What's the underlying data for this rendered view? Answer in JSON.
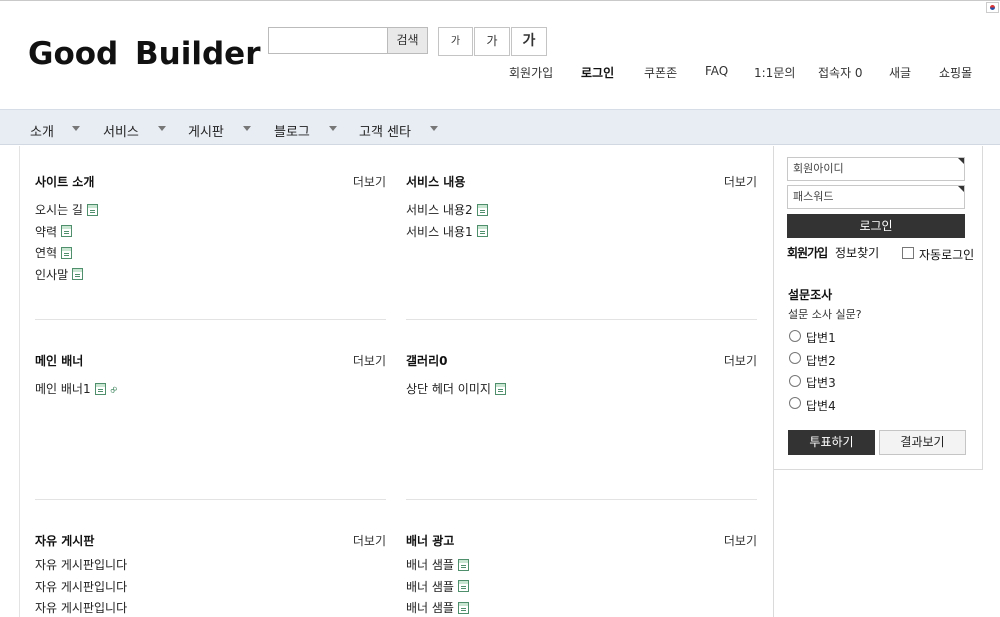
{
  "header": {
    "logo": "Good Builder",
    "search_placeholder": "",
    "search_button": "검색",
    "font_sizes": [
      "가",
      "가",
      "가"
    ],
    "nav": [
      "회원가입",
      "로그인",
      "쿠폰존",
      "FAQ",
      "1:1문의",
      "접속자 0",
      "새글",
      "쇼핑몰"
    ]
  },
  "menu": [
    "소개",
    "서비스",
    "게시판",
    "블로그",
    "고객 센타"
  ],
  "boxes": [
    {
      "title": "사이트 소개",
      "more": "더보기",
      "items": [
        "오시는 길",
        "약력",
        "연혁",
        "인사말"
      ]
    },
    {
      "title": "서비스 내용",
      "more": "더보기",
      "items": [
        "서비스 내용2",
        "서비스 내용1"
      ]
    },
    {
      "title": "메인 배너",
      "more": "더보기",
      "items": [
        "메인 배너1"
      ]
    },
    {
      "title": "갤러리0",
      "more": "더보기",
      "items": [
        "상단 헤더 이미지"
      ]
    },
    {
      "title": "자유 게시판",
      "more": "더보기",
      "items": [
        "자유 게시판입니다",
        "자유 게시판입니다",
        "자유 게시판입니다"
      ]
    },
    {
      "title": "배너 광고",
      "more": "더보기",
      "items": [
        "배너 샘플",
        "배너 샘플",
        "배너 샘플"
      ]
    }
  ],
  "login": {
    "id_placeholder": "회원아이디",
    "pw_placeholder": "패스워드",
    "button": "로그인",
    "join": "회원가입",
    "find": "정보찾기",
    "auto": "자동로그인"
  },
  "poll": {
    "title": "설문조사",
    "question": "설문 소사 실문?",
    "options": [
      "답변1",
      "답변2",
      "답변3",
      "답변4"
    ],
    "vote": "투표하기",
    "result": "결과보기"
  }
}
